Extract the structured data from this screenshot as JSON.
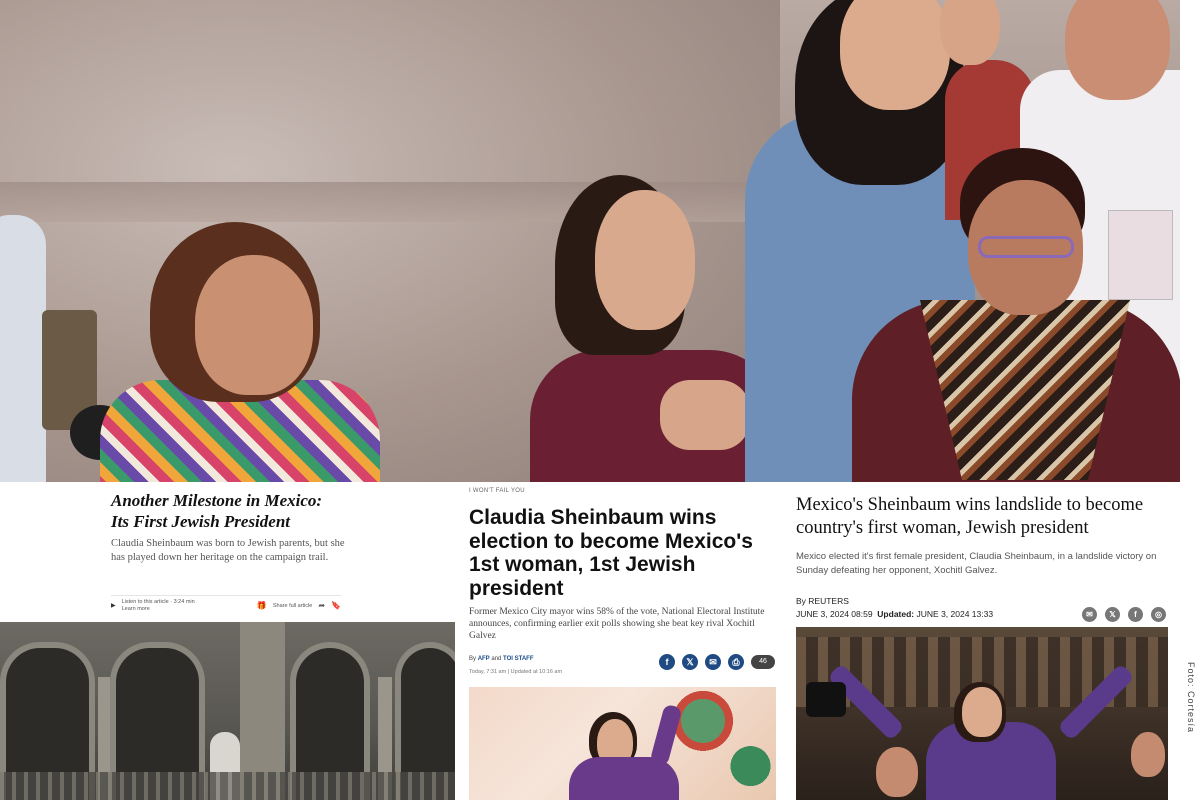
{
  "nyt": {
    "title_line1": "Another Milestone in Mexico:",
    "title_line2": "Its First Jewish President",
    "dek": "Claudia Sheinbaum was born to Jewish parents, but she has played down her heritage on the campaign trail.",
    "listen_label": "Listen to this article · 3:24 min",
    "learn_more": "Learn more",
    "share_label": "Share full article"
  },
  "toi": {
    "kicker": "I WON'T FAIL YOU",
    "title": "Claudia Sheinbaum wins election to become Mexico's 1st woman, 1st Jewish president",
    "dek": "Former Mexico City mayor wins 58% of the vote, National Electoral Institute announces, confirming earlier exit polls showing she beat key rival Xochitl Galvez",
    "byline_prefix": "By",
    "byline_author1": "AFP",
    "byline_and": "and",
    "byline_author2": "TOI STAFF",
    "date": "Today, 7:31 am  |  Updated at 10:16 am",
    "comments_count": "46"
  },
  "reuters": {
    "title": "Mexico's Sheinbaum wins landslide to become country's first woman, Jewish president",
    "dek": "Mexico elected it's first female president, Claudia Sheinbaum, in a landslide victory on Sunday defeating her opponent, Xochitl Galvez.",
    "byline": "By REUTERS",
    "published": "JUNE 3, 2024 08:59",
    "updated_label": "Updated:",
    "updated": "JUNE 3, 2024 13:33"
  },
  "credit": "Foto: Cortesía"
}
